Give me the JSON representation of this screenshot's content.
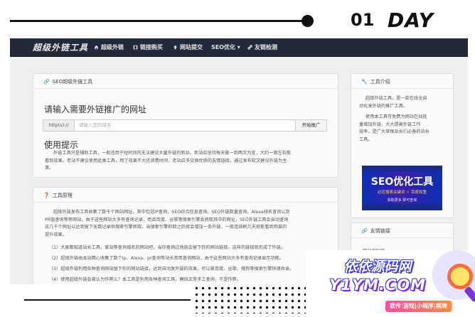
{
  "header": {
    "day_number": "01",
    "day_word": "DAY"
  },
  "nav": {
    "brand": "超级外链工具",
    "items": [
      {
        "label": "超级外链",
        "icon": "home-icon"
      },
      {
        "label": "链接购买",
        "icon": "film-icon"
      },
      {
        "label": "网站提交",
        "icon": "upload-icon"
      },
      {
        "label": "SEO优化 ▾",
        "icon": ""
      },
      {
        "label": "友链检测",
        "icon": "link-icon"
      }
    ]
  },
  "main_panel": {
    "heading": "SEO超级外链工具",
    "title": "请输入需要外链推广的网址",
    "input_addon": "http(s)://",
    "input_placeholder": "请输入您的域名",
    "submit_label": "开始推广",
    "tips_title": "使用提示",
    "tips_lines": [
      "外链工具只是辅助工具，一般适用于短时间内无法建设大量外链的新站，新站应坚持每天做一到两次为宜，大约一周左右能",
      "看到效果。老站不建议使用此类工具，用了效果不大还浪费时间，老站应多交换优质的友情链接，通过发布软文建设外链为主",
      "第。"
    ]
  },
  "principle_panel": {
    "heading": "工具原理",
    "paragraph_lines": [
      "超级外链发布工具收集了数千个网站网址，其中包括IP查询、SEO综合信息查询、SEO外链数量查询、Alexa排名查询以及",
      "PR值查询等等网站。由于这些网站大多有查询记录，而且百度、谷歌等搜索引擎会抓取其中的网址，SEO外链工具会自动查询",
      "这几千个网址以达到留下无数记录供搜索引擎抓取。当搜索引擎抓取之后就会增加一条外链，一般连续刷几天就能看到明显的",
      "提升效果。"
    ],
    "list": [
      "（1）大家都知道站长工具，爱站等查询域名的网站吧，当你查询过他就会留下你的网站链接，这样的链接就形成了外链。",
      "（2）超级外链由本站精心收集了数个ip、Alexa、pr查询等站长常用查询网站，由于这些网站大多有查询记录显示功能。",
      "（3）超级外链利用各种查询网站留下你的网站链接，达到自动发外链的效果，可以被百度、谷歌、搜狗等搜索引擎快速收录。",
      "（4）使用超级外链会被认为作弊么？本工具是利用各种查询工具，模拟正常手工查询，不是作弊。"
    ]
  },
  "side_intro": {
    "heading": "工具介绍",
    "para1_lines": [
      "超级外链工具，是一款在线全自",
      "动化发外链的推广工具。"
    ],
    "para2_lines": [
      "使用本工具可免费为网站在线批",
      "量增加外链，大大提高外链工作",
      "效率，是广大草根站长们必备的站长",
      "工具。"
    ]
  },
  "ad": {
    "title": "SEO优化工具",
    "subtitle": "必应搜索关键词 ☆ 百度权重",
    "footer": "获取更多 即可查询"
  },
  "side_links": {
    "heading": "友情链接",
    "partial_item": "网站源码网"
  },
  "watermark": {
    "cn": "依依源码网",
    "en": "Y1YM.COM",
    "tag": "软件|游戏|小程序|棋牌"
  }
}
